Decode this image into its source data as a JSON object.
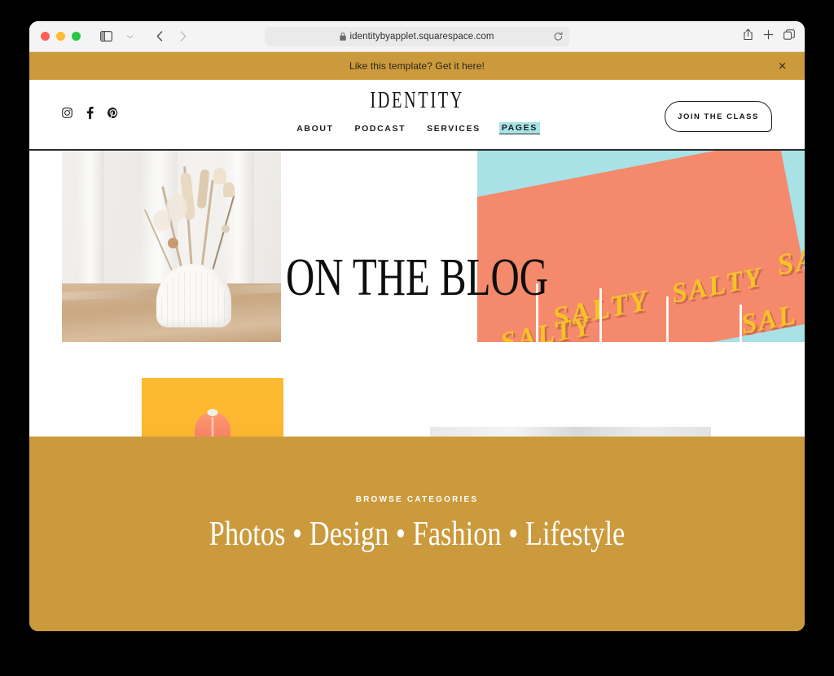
{
  "browser": {
    "url": "identitybyapplet.squarespace.com",
    "lock_icon": "lock-icon",
    "reload_icon": "reload-icon",
    "sidebar_icon": "sidebar-toggle-icon",
    "chevron_icon": "chevron-down-icon",
    "back_icon": "back-arrow-icon",
    "forward_icon": "forward-arrow-icon",
    "share_icon": "share-icon",
    "new_tab_icon": "plus-icon",
    "tabs_icon": "tab-overview-icon",
    "traffic_lights": [
      "close",
      "minimize",
      "maximize"
    ]
  },
  "promo": {
    "text": "Like this template? Get it here!",
    "close_label": "✕",
    "background": "#cb9a3c"
  },
  "site": {
    "logo": "IDENTITY",
    "social": [
      {
        "name": "instagram-icon",
        "label": "Instagram"
      },
      {
        "name": "facebook-icon",
        "label": "Facebook"
      },
      {
        "name": "pinterest-icon",
        "label": "Pinterest"
      }
    ],
    "nav": [
      {
        "label": "ABOUT",
        "active": false
      },
      {
        "label": "PODCAST",
        "active": false
      },
      {
        "label": "SERVICES",
        "active": false
      },
      {
        "label": "PAGES",
        "active": true
      }
    ],
    "cta": {
      "label": "JOIN THE CLASS"
    },
    "nav_highlight_color": "#a9e3e8"
  },
  "hero": {
    "title": "ON THE BLOG",
    "images": [
      {
        "name": "vase-dried-flowers-photo",
        "alt": "White shell vase with dried flowers on linen"
      },
      {
        "name": "salty-poster-photo",
        "alt": "Cyan and coral background with yellow SALTY lettering and straws"
      },
      {
        "name": "peach-on-yellow-photo",
        "alt": "Peach fruit on yellow background"
      },
      {
        "name": "gray-texture-photo",
        "alt": "Light gray texture"
      }
    ],
    "salty_words": [
      "SALTY",
      "SALTY",
      "SA",
      "SALTY",
      "SAL"
    ]
  },
  "footer": {
    "browse_label": "BROWSE CATEGORIES",
    "categories_line": "Photos • Design • Fashion • Lifestyle",
    "categories": [
      "Photos",
      "Design",
      "Fashion",
      "Lifestyle"
    ],
    "background": "#cb9a3c"
  }
}
